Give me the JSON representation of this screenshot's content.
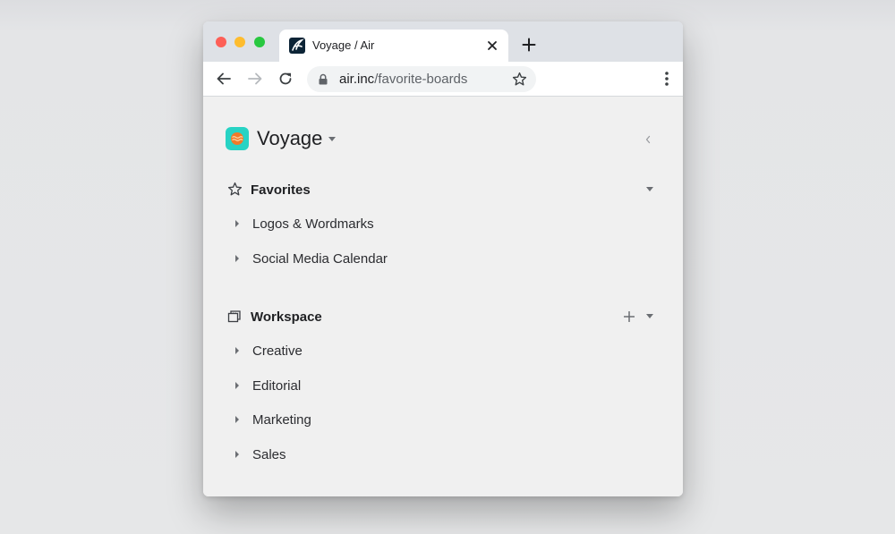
{
  "browser": {
    "tab_title": "Voyage / Air",
    "url_host": "air.inc",
    "url_path": "/favorite-boards"
  },
  "sidebar": {
    "workspace_name": "Voyage",
    "favorites": {
      "label": "Favorites",
      "items": [
        {
          "label": "Logos & Wordmarks"
        },
        {
          "label": "Social Media Calendar"
        }
      ]
    },
    "workspace": {
      "label": "Workspace",
      "items": [
        {
          "label": "Creative"
        },
        {
          "label": "Editorial"
        },
        {
          "label": "Marketing"
        },
        {
          "label": "Sales"
        }
      ]
    }
  },
  "colors": {
    "logo_teal": "#27d3c4",
    "logo_orange": "#f07a2a",
    "traffic_red": "#fd5f57",
    "traffic_yellow": "#febc2e",
    "traffic_green": "#28c840"
  },
  "icons": [
    "close-icon",
    "plus-icon",
    "back-arrow-icon",
    "forward-arrow-icon",
    "reload-icon",
    "lock-icon",
    "star-icon",
    "more-vertical-icon",
    "chevron-left-icon",
    "boards-icon"
  ]
}
